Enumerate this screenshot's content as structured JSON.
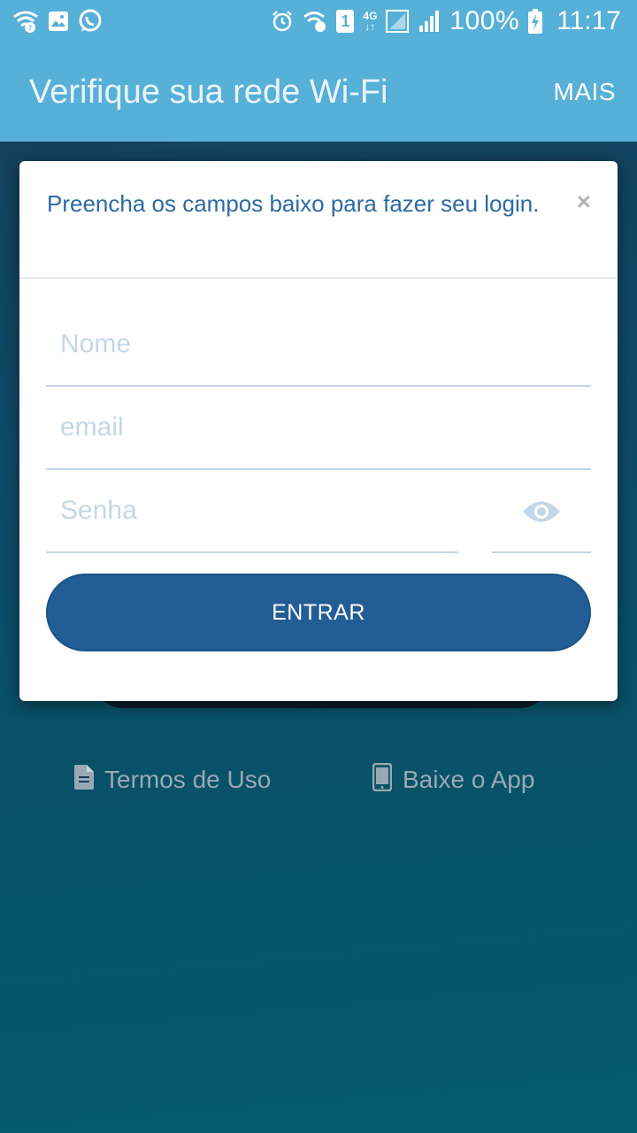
{
  "status_bar": {
    "network_type": "4G",
    "sim_slot": "1",
    "battery_percent": "100%",
    "time": "11:17",
    "icons_left": [
      "wifi-question-icon",
      "image-icon",
      "whatsapp-icon"
    ],
    "icons_right": [
      "alarm-icon",
      "wifi-calling-icon",
      "sim-1-icon",
      "4g-icon",
      "signal-sim1-icon",
      "signal-sim2-icon",
      "battery-charging-icon"
    ]
  },
  "app_bar": {
    "title": "Verifique sua rede Wi-Fi",
    "more_label": "MAIS"
  },
  "modal": {
    "message": "Preencha os campos baixo para fazer seu login.",
    "close_symbol": "×",
    "name_placeholder": "Nome",
    "email_placeholder": "email",
    "password_placeholder": "Senha",
    "submit_label": "ENTRAR"
  },
  "footer": {
    "terms_label": "Termos de Uso",
    "app_label": "Baixe o App"
  },
  "colors": {
    "status_bar": "#56b0d8",
    "modal_text": "#2e6aa4",
    "button_bg": "#235d96",
    "footer_text": "#97a9b5"
  }
}
